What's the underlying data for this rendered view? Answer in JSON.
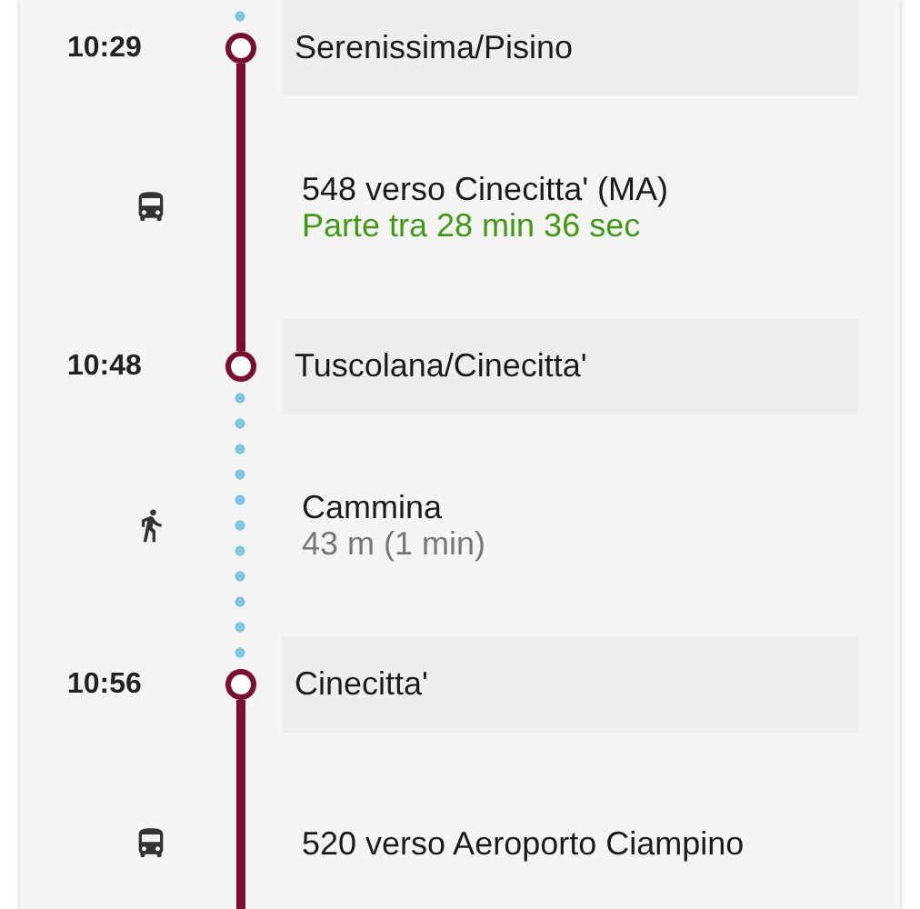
{
  "itinerary": {
    "lead_in": {
      "kind": "walk"
    },
    "steps": [
      {
        "kind": "stop",
        "time": "10:29",
        "name": "Serenissima/Pisino"
      },
      {
        "kind": "bus",
        "title": "548 verso Cinecitta' (MA)",
        "detail": {
          "kind": "departure",
          "text": "Parte tra 28 min 36 sec"
        }
      },
      {
        "kind": "stop",
        "time": "10:48",
        "name": "Tuscolana/Cinecitta'"
      },
      {
        "kind": "walk",
        "title": "Cammina",
        "detail": {
          "kind": "distance",
          "text": "43 m (1 min)"
        }
      },
      {
        "kind": "stop",
        "time": "10:56",
        "name": "Cinecitta'"
      },
      {
        "kind": "bus",
        "title": "520 verso Aeroporto Ciampino"
      }
    ]
  }
}
